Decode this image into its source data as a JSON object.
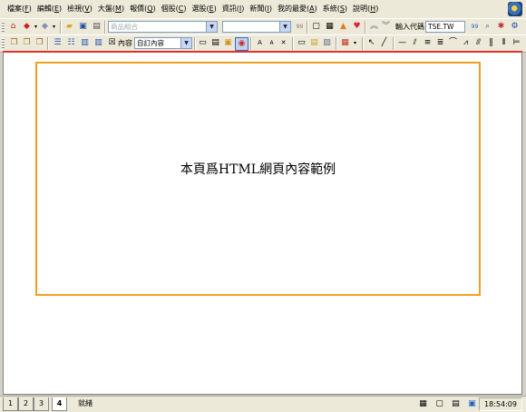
{
  "menu": [
    {
      "label": "檔案",
      "key": "F"
    },
    {
      "label": "編輯",
      "key": "E"
    },
    {
      "label": "檢視",
      "key": "V"
    },
    {
      "label": "大盤",
      "key": "M"
    },
    {
      "label": "報價",
      "key": "Q"
    },
    {
      "label": "個股",
      "key": "C"
    },
    {
      "label": "選股",
      "key": "E"
    },
    {
      "label": "資訊",
      "key": "I"
    },
    {
      "label": "新聞",
      "key": "I"
    },
    {
      "label": "我的最愛",
      "key": "A"
    },
    {
      "label": "系統",
      "key": "S"
    },
    {
      "label": "說明",
      "key": "H"
    }
  ],
  "toolbar1": {
    "product_combo_placeholder": "商品組合",
    "input_code_label": "輸入代碼",
    "input_code_value": "TSE.TW"
  },
  "toolbar2": {
    "content_label": "內容",
    "content_combo_value": "自訂內容"
  },
  "content": {
    "message": "本頁爲HTML網頁內容範例"
  },
  "status": {
    "tabs": [
      "1",
      "2",
      "3",
      "4"
    ],
    "active_tab": "4",
    "text": "就緒",
    "clock": "18:54:09"
  }
}
